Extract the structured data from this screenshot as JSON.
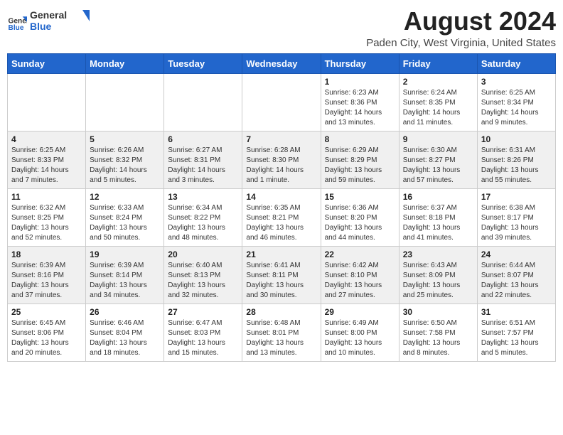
{
  "header": {
    "logo_general": "General",
    "logo_blue": "Blue",
    "main_title": "August 2024",
    "subtitle": "Paden City, West Virginia, United States"
  },
  "calendar": {
    "days_of_week": [
      "Sunday",
      "Monday",
      "Tuesday",
      "Wednesday",
      "Thursday",
      "Friday",
      "Saturday"
    ],
    "weeks": [
      [
        {
          "day": "",
          "info": ""
        },
        {
          "day": "",
          "info": ""
        },
        {
          "day": "",
          "info": ""
        },
        {
          "day": "",
          "info": ""
        },
        {
          "day": "1",
          "info": "Sunrise: 6:23 AM\nSunset: 8:36 PM\nDaylight: 14 hours\nand 13 minutes."
        },
        {
          "day": "2",
          "info": "Sunrise: 6:24 AM\nSunset: 8:35 PM\nDaylight: 14 hours\nand 11 minutes."
        },
        {
          "day": "3",
          "info": "Sunrise: 6:25 AM\nSunset: 8:34 PM\nDaylight: 14 hours\nand 9 minutes."
        }
      ],
      [
        {
          "day": "4",
          "info": "Sunrise: 6:25 AM\nSunset: 8:33 PM\nDaylight: 14 hours\nand 7 minutes."
        },
        {
          "day": "5",
          "info": "Sunrise: 6:26 AM\nSunset: 8:32 PM\nDaylight: 14 hours\nand 5 minutes."
        },
        {
          "day": "6",
          "info": "Sunrise: 6:27 AM\nSunset: 8:31 PM\nDaylight: 14 hours\nand 3 minutes."
        },
        {
          "day": "7",
          "info": "Sunrise: 6:28 AM\nSunset: 8:30 PM\nDaylight: 14 hours\nand 1 minute."
        },
        {
          "day": "8",
          "info": "Sunrise: 6:29 AM\nSunset: 8:29 PM\nDaylight: 13 hours\nand 59 minutes."
        },
        {
          "day": "9",
          "info": "Sunrise: 6:30 AM\nSunset: 8:27 PM\nDaylight: 13 hours\nand 57 minutes."
        },
        {
          "day": "10",
          "info": "Sunrise: 6:31 AM\nSunset: 8:26 PM\nDaylight: 13 hours\nand 55 minutes."
        }
      ],
      [
        {
          "day": "11",
          "info": "Sunrise: 6:32 AM\nSunset: 8:25 PM\nDaylight: 13 hours\nand 52 minutes."
        },
        {
          "day": "12",
          "info": "Sunrise: 6:33 AM\nSunset: 8:24 PM\nDaylight: 13 hours\nand 50 minutes."
        },
        {
          "day": "13",
          "info": "Sunrise: 6:34 AM\nSunset: 8:22 PM\nDaylight: 13 hours\nand 48 minutes."
        },
        {
          "day": "14",
          "info": "Sunrise: 6:35 AM\nSunset: 8:21 PM\nDaylight: 13 hours\nand 46 minutes."
        },
        {
          "day": "15",
          "info": "Sunrise: 6:36 AM\nSunset: 8:20 PM\nDaylight: 13 hours\nand 44 minutes."
        },
        {
          "day": "16",
          "info": "Sunrise: 6:37 AM\nSunset: 8:18 PM\nDaylight: 13 hours\nand 41 minutes."
        },
        {
          "day": "17",
          "info": "Sunrise: 6:38 AM\nSunset: 8:17 PM\nDaylight: 13 hours\nand 39 minutes."
        }
      ],
      [
        {
          "day": "18",
          "info": "Sunrise: 6:39 AM\nSunset: 8:16 PM\nDaylight: 13 hours\nand 37 minutes."
        },
        {
          "day": "19",
          "info": "Sunrise: 6:39 AM\nSunset: 8:14 PM\nDaylight: 13 hours\nand 34 minutes."
        },
        {
          "day": "20",
          "info": "Sunrise: 6:40 AM\nSunset: 8:13 PM\nDaylight: 13 hours\nand 32 minutes."
        },
        {
          "day": "21",
          "info": "Sunrise: 6:41 AM\nSunset: 8:11 PM\nDaylight: 13 hours\nand 30 minutes."
        },
        {
          "day": "22",
          "info": "Sunrise: 6:42 AM\nSunset: 8:10 PM\nDaylight: 13 hours\nand 27 minutes."
        },
        {
          "day": "23",
          "info": "Sunrise: 6:43 AM\nSunset: 8:09 PM\nDaylight: 13 hours\nand 25 minutes."
        },
        {
          "day": "24",
          "info": "Sunrise: 6:44 AM\nSunset: 8:07 PM\nDaylight: 13 hours\nand 22 minutes."
        }
      ],
      [
        {
          "day": "25",
          "info": "Sunrise: 6:45 AM\nSunset: 8:06 PM\nDaylight: 13 hours\nand 20 minutes."
        },
        {
          "day": "26",
          "info": "Sunrise: 6:46 AM\nSunset: 8:04 PM\nDaylight: 13 hours\nand 18 minutes."
        },
        {
          "day": "27",
          "info": "Sunrise: 6:47 AM\nSunset: 8:03 PM\nDaylight: 13 hours\nand 15 minutes."
        },
        {
          "day": "28",
          "info": "Sunrise: 6:48 AM\nSunset: 8:01 PM\nDaylight: 13 hours\nand 13 minutes."
        },
        {
          "day": "29",
          "info": "Sunrise: 6:49 AM\nSunset: 8:00 PM\nDaylight: 13 hours\nand 10 minutes."
        },
        {
          "day": "30",
          "info": "Sunrise: 6:50 AM\nSunset: 7:58 PM\nDaylight: 13 hours\nand 8 minutes."
        },
        {
          "day": "31",
          "info": "Sunrise: 6:51 AM\nSunset: 7:57 PM\nDaylight: 13 hours\nand 5 minutes."
        }
      ]
    ]
  }
}
